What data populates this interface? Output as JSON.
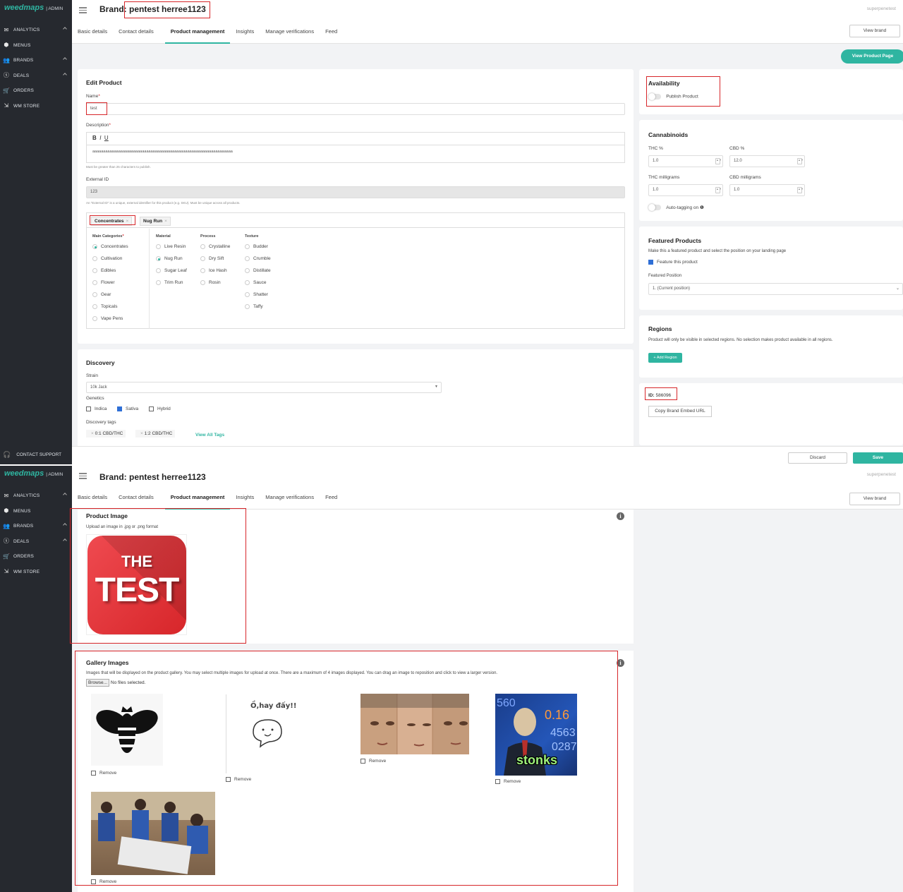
{
  "app": {
    "logo": "weedmaps",
    "logo_suffix": "| ADMIN"
  },
  "sidebar": {
    "items": [
      {
        "label": "ANALYTICS",
        "icon": "mail-icon"
      },
      {
        "label": "MENUS",
        "icon": "box-icon"
      },
      {
        "label": "BRANDS",
        "icon": "users-icon"
      },
      {
        "label": "DEALS",
        "icon": "deal-icon"
      },
      {
        "label": "ORDERS",
        "icon": "cart-icon"
      },
      {
        "label": "WM STORE",
        "icon": "store-icon"
      }
    ],
    "support": "CONTACT SUPPORT"
  },
  "header": {
    "brand_prefix": "Brand:",
    "brand_name": "pentest herree1123",
    "brand_full": "Brand: pentest herree1123",
    "user": "superpenetest"
  },
  "tabs": [
    "Basic details",
    "Contact details",
    "Product management",
    "Insights",
    "Manage verifications",
    "Feed"
  ],
  "buttons": {
    "view_brand": "View brand",
    "view_product_page": "View Product Page",
    "discard": "Discard",
    "save": "Save",
    "add_region": "+ Add Region",
    "copy_embed": "Copy Brand Embed URL",
    "view_all_tags": "View All Tags"
  },
  "edit_product": {
    "title": "Edit Product",
    "name_label": "Name",
    "name_value": "test",
    "description_label": "Description",
    "description_value": "aaaaaaaaaaaaaaaaaaaaaaaaaaaaaaaaaaaaaaaaaaaaaaaaaaaaaaaaaaaaaaaaa",
    "description_hint": "Must be greater than 25 characters to publish.",
    "external_id_label": "External ID",
    "external_id_value": "123",
    "external_id_hint": "An \"External ID\" is a unique, external identifier for this product (e.g. SKU). Must be unique across all products.",
    "selected_tags": [
      "Concentrates",
      "Nug Run"
    ],
    "columns": {
      "main": "Main Categories",
      "material": "Material",
      "process": "Process",
      "texture": "Texture"
    },
    "main_categories": [
      "Concentrates",
      "Cultivation",
      "Edibles",
      "Flower",
      "Gear",
      "Topicals",
      "Vape Pens"
    ],
    "material": [
      "Live Resin",
      "Nug Run",
      "Sugar Leaf",
      "Trim Run"
    ],
    "process": [
      "Crystalline",
      "Dry Sift",
      "Ice Hash",
      "Rosin"
    ],
    "texture": [
      "Budder",
      "Crumble",
      "Distillate",
      "Sauce",
      "Shatter",
      "Taffy"
    ]
  },
  "discovery": {
    "title": "Discovery",
    "strain_label": "Strain",
    "strain_value": "10k Jack",
    "genetics_label": "Genetics",
    "genetics": [
      "Indica",
      "Sativa",
      "Hybrid"
    ],
    "tags_label": "Discovery tags",
    "tags": [
      "0:1 CBD/THC",
      "1:2 CBD/THC"
    ]
  },
  "availability": {
    "title": "Availability",
    "publish": "Publish Product"
  },
  "cannabinoids": {
    "title": "Cannabinoids",
    "thc_pct_label": "THC %",
    "thc_pct": "1.0",
    "cbd_pct_label": "CBD %",
    "cbd_pct": "12.0",
    "thc_mg_label": "THC milligrams",
    "thc_mg": "1.0",
    "cbd_mg_label": "CBD milligrams",
    "cbd_mg": "1.0",
    "autotag": "Auto-tagging on"
  },
  "featured": {
    "title": "Featured Products",
    "desc": "Make this a featured product and select the position on your landing page",
    "feature_label": "Feature this product",
    "position_label": "Featured Position",
    "position_value": "1. (Current position)"
  },
  "regions": {
    "title": "Regions",
    "desc": "Product will only be visible in selected regions. No selection makes product available in all regions."
  },
  "id": {
    "label": "ID:",
    "value": "586096"
  },
  "product_image": {
    "title": "Product Image",
    "desc": "Upload an image in .jpg or .png format",
    "logo_line1": "THE",
    "logo_line2": "TEST"
  },
  "gallery": {
    "title": "Gallery Images",
    "desc": "Images that will be displayed on the product gallery. You may select multiple images for upload at once. There are a maximum of 4 images displayed. You can drag an image to reposition and click to view a larger version.",
    "browse": "Browse...",
    "no_files": "No files selected.",
    "remove": "Remove",
    "meme_text": "Ồ,hay đấy!!",
    "stonks": "stonks"
  },
  "colors": {
    "accent": "#2fb5a1",
    "sidebar": "#26292f",
    "highlight": "#d7262a"
  }
}
